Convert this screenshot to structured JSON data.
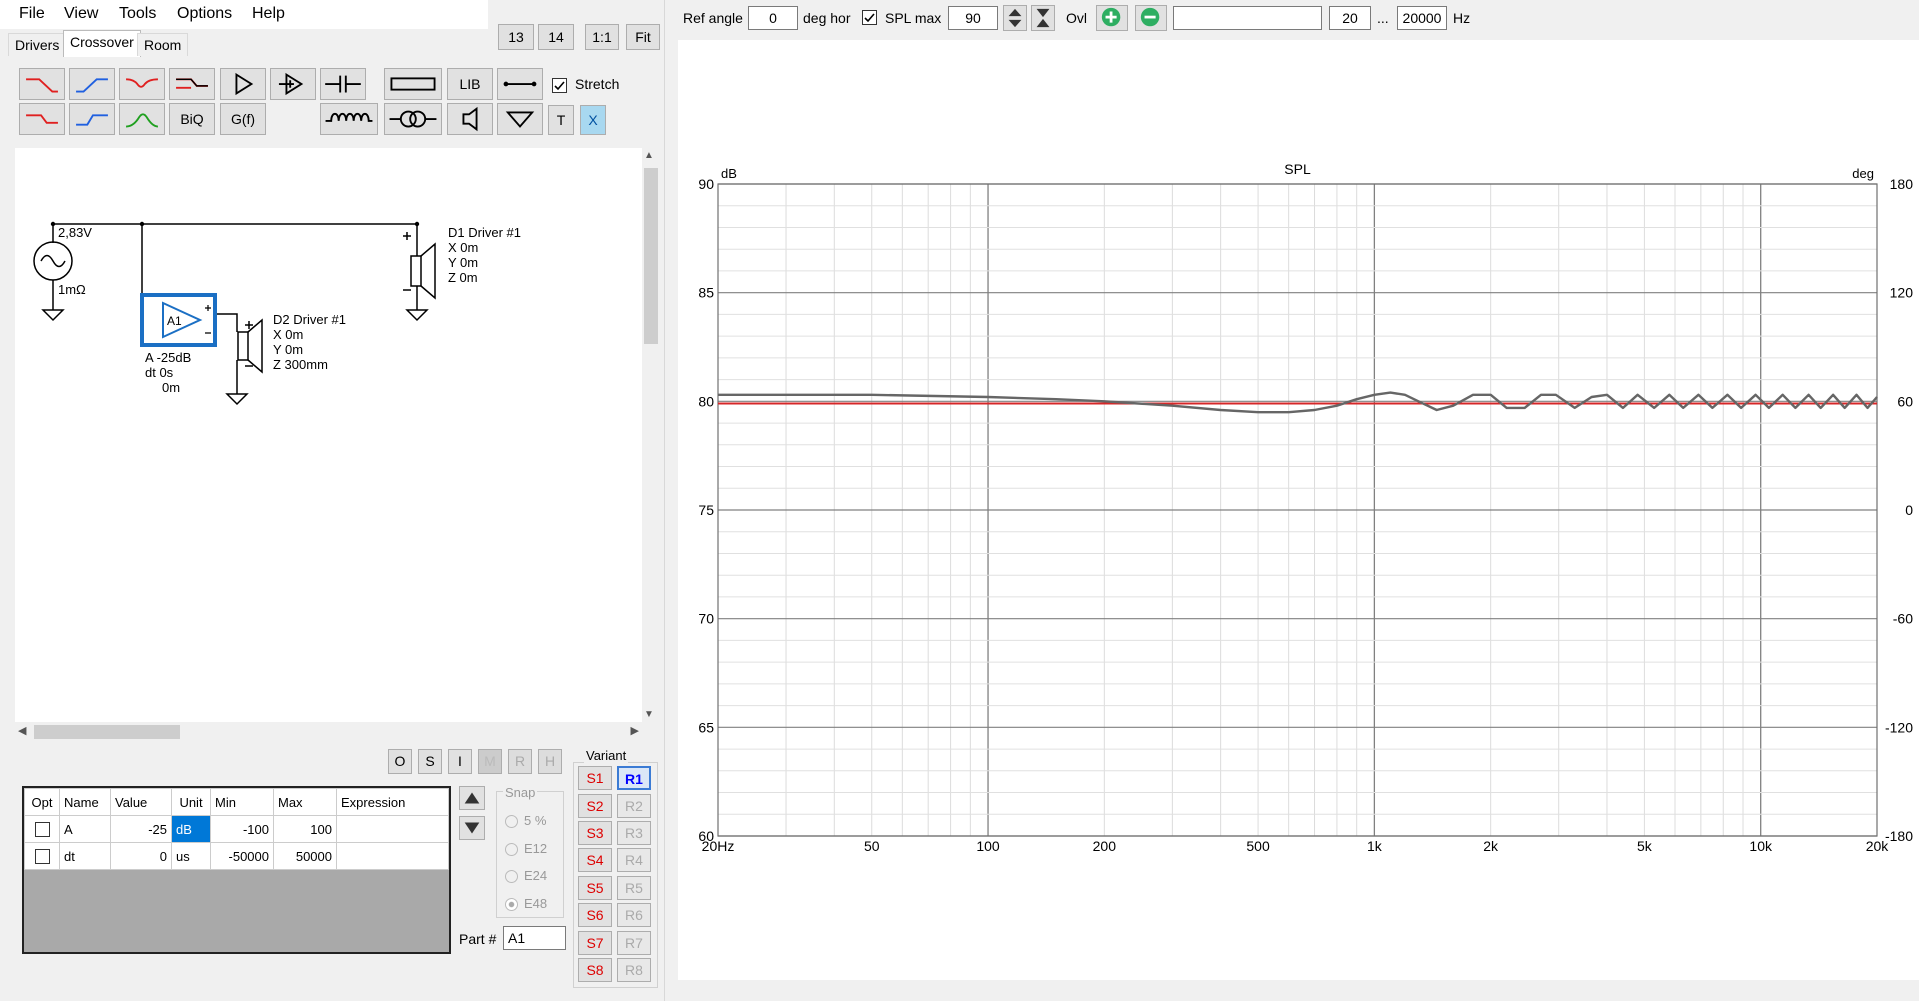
{
  "menu": [
    "File",
    "View",
    "Tools",
    "Options",
    "Help"
  ],
  "tabs": [
    "Drivers",
    "Crossover",
    "Room"
  ],
  "top_buttons": [
    "13",
    "14",
    "1:1",
    "Fit"
  ],
  "toolbar": {
    "biq": "BiQ",
    "gf": "G(f)",
    "lib": "LIB",
    "stretch": "Stretch",
    "t": "T",
    "x": "X"
  },
  "schematic": {
    "source_voltage": "2,83V",
    "source_impedance": "1mΩ",
    "amp_label": "A1",
    "amp_props": [
      "A -25dB",
      "dt 0s",
      "0m"
    ],
    "d1": [
      "D1 Driver #1",
      "X 0m",
      "Y 0m",
      "Z 0m"
    ],
    "d2": [
      "D2 Driver #1",
      "X 0m",
      "Y 0m",
      "Z 300mm"
    ]
  },
  "param_buttons": [
    "O",
    "S",
    "I",
    "M",
    "R",
    "H"
  ],
  "param_table": {
    "headers": [
      "Opt",
      "Name",
      "Value",
      "Unit",
      "Min",
      "Max",
      "Expression"
    ],
    "rows": [
      {
        "name": "A",
        "value": "-25",
        "unit": "dB",
        "min": "-100",
        "max": "100",
        "expr": ""
      },
      {
        "name": "dt",
        "value": "0",
        "unit": "us",
        "min": "-50000",
        "max": "50000",
        "expr": ""
      }
    ]
  },
  "snap": {
    "title": "Snap",
    "options": [
      "5 %",
      "E12",
      "E24",
      "E48"
    ],
    "selected": "E48"
  },
  "part": {
    "label": "Part #",
    "value": "A1"
  },
  "variant": {
    "title": "Variant",
    "s": [
      "S1",
      "S2",
      "S3",
      "S4",
      "S5",
      "S6",
      "S7",
      "S8"
    ],
    "r": [
      "R1",
      "R2",
      "R3",
      "R4",
      "R5",
      "R6",
      "R7",
      "R8"
    ]
  },
  "plotbar": {
    "ref_angle_label": "Ref angle",
    "ref_angle": "0",
    "deg_hor": "deg hor",
    "spl_max_label": "SPL max",
    "spl_max": "90",
    "ovl": "Ovl",
    "freq_min": "20",
    "ellipsis": "...",
    "freq_max": "20000",
    "hz": "Hz"
  },
  "chart_data": {
    "type": "line",
    "title": "SPL",
    "ylabel": "dB",
    "y2label": "deg",
    "xscale": "log",
    "xlim": [
      20,
      20000
    ],
    "ylim": [
      60,
      90
    ],
    "y2lim": [
      -180,
      180
    ],
    "x_ticks": [
      {
        "v": 20,
        "t": "20Hz"
      },
      {
        "v": 50,
        "t": "50"
      },
      {
        "v": 100,
        "t": "100"
      },
      {
        "v": 200,
        "t": "200"
      },
      {
        "v": 500,
        "t": "500"
      },
      {
        "v": 1000,
        "t": "1k"
      },
      {
        "v": 2000,
        "t": "2k"
      },
      {
        "v": 5000,
        "t": "5k"
      },
      {
        "v": 10000,
        "t": "10k"
      },
      {
        "v": 20000,
        "t": "20k"
      }
    ],
    "y_ticks": [
      60,
      65,
      70,
      75,
      80,
      85,
      90
    ],
    "y2_ticks": [
      -180,
      -120,
      -60,
      0,
      60,
      120,
      180
    ],
    "grid": true,
    "series": [
      {
        "color": "#d62728",
        "x": [
          20,
          20000
        ],
        "y": [
          79.9,
          79.9
        ]
      },
      {
        "color": "#666666",
        "x": [
          20,
          50,
          100,
          150,
          200,
          300,
          400,
          500,
          600,
          700,
          800,
          900,
          1000,
          1100,
          1200,
          1300,
          1450,
          1600,
          1800,
          2000,
          2200,
          2450,
          2700,
          2950,
          3300,
          3650,
          4000,
          4400,
          4800,
          5300,
          5800,
          6300,
          6900,
          7500,
          8200,
          8900,
          9700,
          10500,
          11400,
          12300,
          13300,
          14300,
          15400,
          16500,
          17700,
          18900,
          20000
        ],
        "y": [
          80.3,
          80.3,
          80.2,
          80.1,
          80.0,
          79.8,
          79.6,
          79.5,
          79.5,
          79.6,
          79.8,
          80.1,
          80.3,
          80.4,
          80.3,
          80.0,
          79.6,
          79.8,
          80.3,
          80.3,
          79.7,
          79.7,
          80.3,
          80.3,
          79.7,
          80.2,
          80.3,
          79.7,
          80.3,
          79.7,
          80.3,
          79.7,
          80.3,
          79.7,
          80.3,
          79.7,
          80.3,
          79.7,
          80.3,
          79.7,
          80.3,
          79.7,
          80.3,
          79.7,
          80.3,
          79.7,
          80.2
        ]
      }
    ]
  }
}
